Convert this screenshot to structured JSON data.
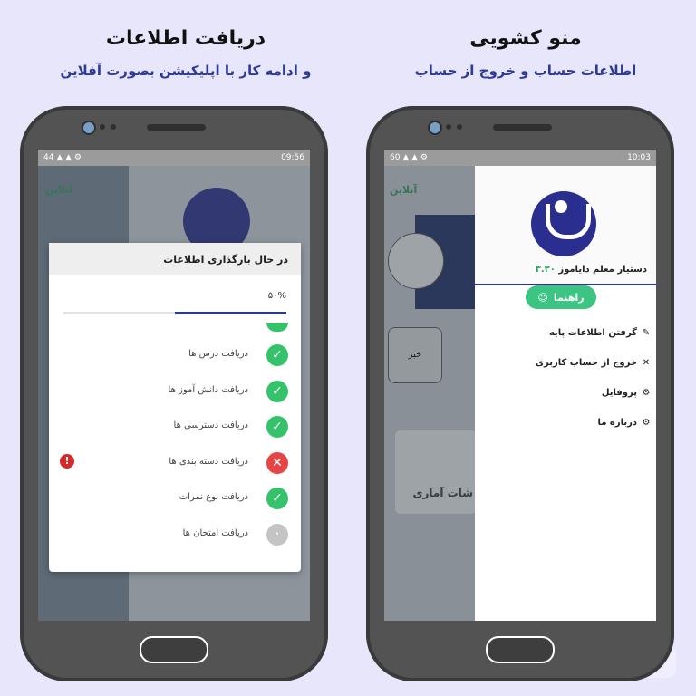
{
  "left_panel": {
    "title": "دریافت اطلاعات",
    "subtitle": "و ادامه کار با اپلیکیشن بصورت آفلاین",
    "status_left": "44 ▲ ▲ ⚙",
    "status_right": "09:56",
    "online_label": "آنلاین",
    "dialog": {
      "title": "در حال بارگذاری اطلاعات",
      "progress_text": "۵۰%",
      "progress": 0.5,
      "items": [
        {
          "label": "دریافت درس ها",
          "status": "ok"
        },
        {
          "label": "دریافت دانش آموز ها",
          "status": "ok"
        },
        {
          "label": "دریافت دسترسی ها",
          "status": "ok"
        },
        {
          "label": "دریافت دسته بندی ها",
          "status": "error"
        },
        {
          "label": "دریافت نوع نمرات",
          "status": "ok"
        },
        {
          "label": "دریافت امتحان ها",
          "status": "waiting"
        }
      ]
    }
  },
  "right_panel": {
    "title": "منو کشویی",
    "subtitle": "اطلاعات حساب و خروج از حساب",
    "status_left": "60 ▲ ▲ ⚙",
    "status_right": "10:03",
    "online_label": "آنلاین",
    "drawer": {
      "app_name": "دستیار معلم دایاموز",
      "version": "۳.۳۰",
      "help_button": "راهنما",
      "menu": [
        {
          "label": "گرفتن اطلاعات پایه",
          "icon": "pencil-icon"
        },
        {
          "label": "خروج از حساب کاربری",
          "icon": "close-icon"
        },
        {
          "label": "پروفایل",
          "icon": "gear-icon"
        },
        {
          "label": "درباره ما",
          "icon": "gear-icon"
        }
      ]
    },
    "background": {
      "button_label": "خبر",
      "stats_label": "شات آماری"
    }
  },
  "colors": {
    "accent_blue": "#2d3a9c",
    "success_green": "#34c36a",
    "error_red": "#e74545"
  }
}
